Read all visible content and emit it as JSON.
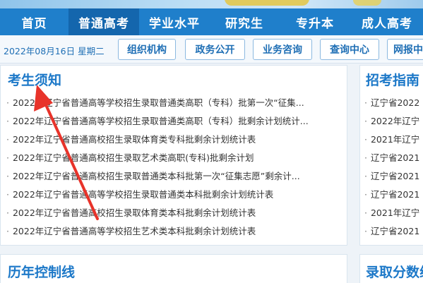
{
  "nav": {
    "items": [
      {
        "label": "首页"
      },
      {
        "label": "普通高考"
      },
      {
        "label": "学业水平"
      },
      {
        "label": "研究生"
      },
      {
        "label": "专升本"
      },
      {
        "label": "成人高考"
      }
    ]
  },
  "subbar": {
    "date": "2022年08月16日 星期二",
    "buttons": [
      {
        "label": "组织机构"
      },
      {
        "label": "政务公开"
      },
      {
        "label": "业务咨询"
      },
      {
        "label": "查询中心"
      },
      {
        "label": "网报中"
      }
    ]
  },
  "notice": {
    "title": "考生须知",
    "items": [
      "2022年辽宁省普通高等学校招生录取普通类高职（专科）批第一次“征集...",
      "2022年辽宁省普通高等学校招生录取普通类高职（专科）批剩余计划统计...",
      "2022年辽宁省普通高校招生录取体育类专科批剩余计划统计表",
      "2022年辽宁省普通高校招生录取艺术类高职(专科)批剩余计划",
      "2022年辽宁省普通高校招生录取普通类本科批第一次“征集志愿”剩余计...",
      "2022年辽宁省普通高等学校招生录取普通类本科批剩余计划统计表",
      "2022年辽宁省普通高校招生录取体育类本科批剩余计划统计表",
      "2022年辽宁省普通高等学校招生艺术类本科批剩余计划统计表"
    ]
  },
  "guide": {
    "title": "招考指南",
    "items": [
      "辽宁省2022",
      "2022年辽宁",
      "2021年辽宁",
      "辽宁省2021",
      "辽宁省2021",
      "辽宁省2021",
      "2021年辽宁",
      "辽宁省2021"
    ]
  },
  "history": {
    "title": "历年控制线"
  },
  "scores": {
    "title": "录取分数线"
  },
  "colors": {
    "nav": "#1f7fcb",
    "nav_active": "#1466ad",
    "title": "#1c78c8",
    "arrow": "#e8332a"
  }
}
